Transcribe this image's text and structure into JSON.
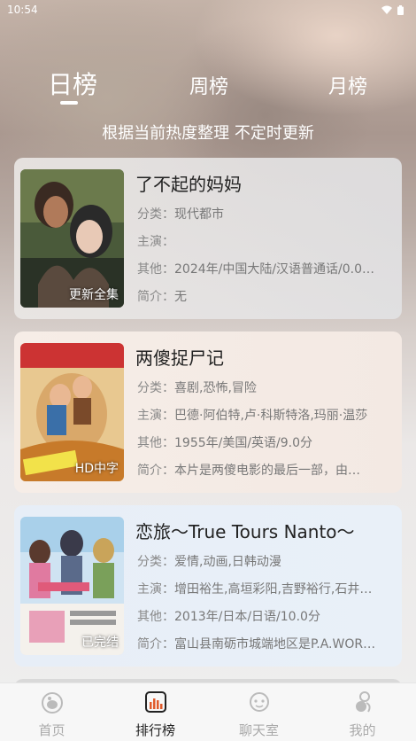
{
  "status_bar": {
    "time": "10:54"
  },
  "tabs": [
    {
      "label": "日榜",
      "active": true
    },
    {
      "label": "周榜",
      "active": false
    },
    {
      "label": "月榜",
      "active": false
    }
  ],
  "subtitle": "根据当前热度整理 不定时更新",
  "items": [
    {
      "title": "了不起的妈妈",
      "badge": "更新全集",
      "category_label": "分类：",
      "category": "现代都市",
      "cast_label": "主演：",
      "cast": "",
      "other_label": "其他：",
      "other": "2024年/中国大陆/汉语普通话/0.0…",
      "intro_label": "简介：",
      "intro": "无"
    },
    {
      "title": "两傻捉尸记",
      "badge": "HD中字",
      "category_label": "分类：",
      "category": "喜剧,恐怖,冒险",
      "cast_label": "主演：",
      "cast": "巴德·阿伯特,卢·科斯特洛,玛丽·温莎",
      "other_label": "其他：",
      "other": "1955年/美国/英语/9.0分",
      "intro_label": "简介：",
      "intro": "本片是两傻电影的最后一部，由…"
    },
    {
      "title": "恋旅～True Tours Nanto～",
      "badge": "已完结",
      "category_label": "分类：",
      "category": "爱情,动画,日韩动漫",
      "cast_label": "主演：",
      "cast": "增田裕生,高垣彩阳,吉野裕行,石井…",
      "other_label": "其他：",
      "other": "2013年/日本/日语/10.0分",
      "intro_label": "简介：",
      "intro": "富山县南砺市城端地区是P.A.WOR…"
    }
  ],
  "bottom_nav": [
    {
      "label": "首页",
      "icon": "home-icon",
      "active": false
    },
    {
      "label": "排行榜",
      "icon": "ranking-icon",
      "active": true
    },
    {
      "label": "聊天室",
      "icon": "chat-icon",
      "active": false
    },
    {
      "label": "我的",
      "icon": "profile-icon",
      "active": false
    }
  ],
  "colors": {
    "active_text": "#222222",
    "inactive_text": "#aaaaaa",
    "ranking_icon": "#e05a2b"
  }
}
